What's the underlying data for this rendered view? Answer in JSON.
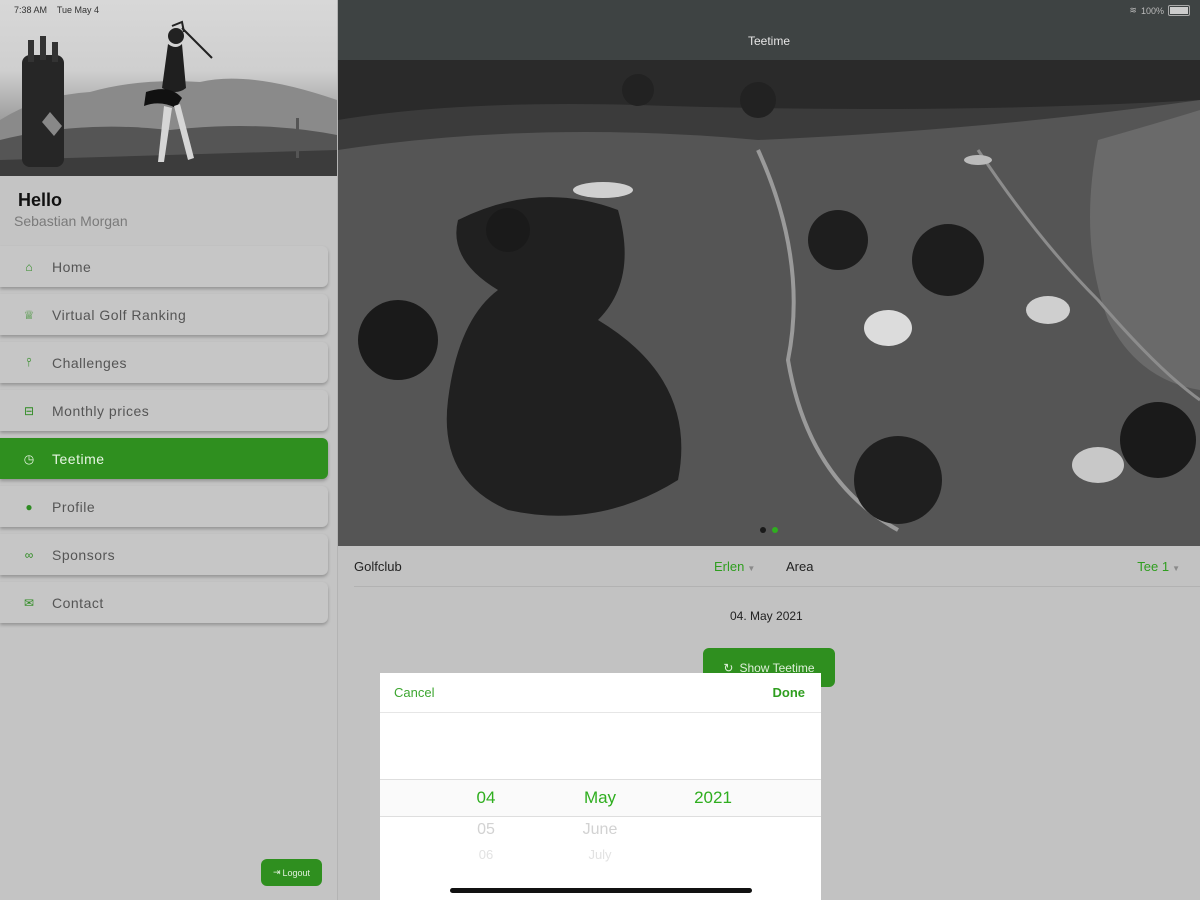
{
  "status": {
    "time": "7:38 AM",
    "date": "Tue May 4",
    "battery": "100%"
  },
  "sidebar": {
    "greeting": "Hello",
    "user_name": "Sebastian Morgan",
    "items": [
      {
        "label": "Home",
        "icon": "home-icon"
      },
      {
        "label": "Virtual Golf Ranking",
        "icon": "trophy-icon"
      },
      {
        "label": "Challenges",
        "icon": "golf-tee-icon"
      },
      {
        "label": "Monthly prices",
        "icon": "gift-icon"
      },
      {
        "label": "Teetime",
        "icon": "stopwatch-icon",
        "active": true
      },
      {
        "label": "Profile",
        "icon": "person-icon"
      },
      {
        "label": "Sponsors",
        "icon": "handshake-icon"
      },
      {
        "label": "Contact",
        "icon": "mail-icon"
      }
    ],
    "logout_label": "Logout"
  },
  "header": {
    "title": "Teetime"
  },
  "form": {
    "golfclub_label": "Golfclub",
    "golfclub_value": "Erlen",
    "area_label": "Area",
    "area_value": "Tee 1",
    "date": "04. May 2021",
    "show_button": "Show Teetime"
  },
  "picker": {
    "cancel": "Cancel",
    "done": "Done",
    "day": "04",
    "month": "May",
    "year": "2021",
    "next_day": "05",
    "next_month": "June",
    "next2_day": "06",
    "next2_month": "July"
  },
  "colors": {
    "accent": "#2f8f1f",
    "topbar": "#3e4343"
  }
}
